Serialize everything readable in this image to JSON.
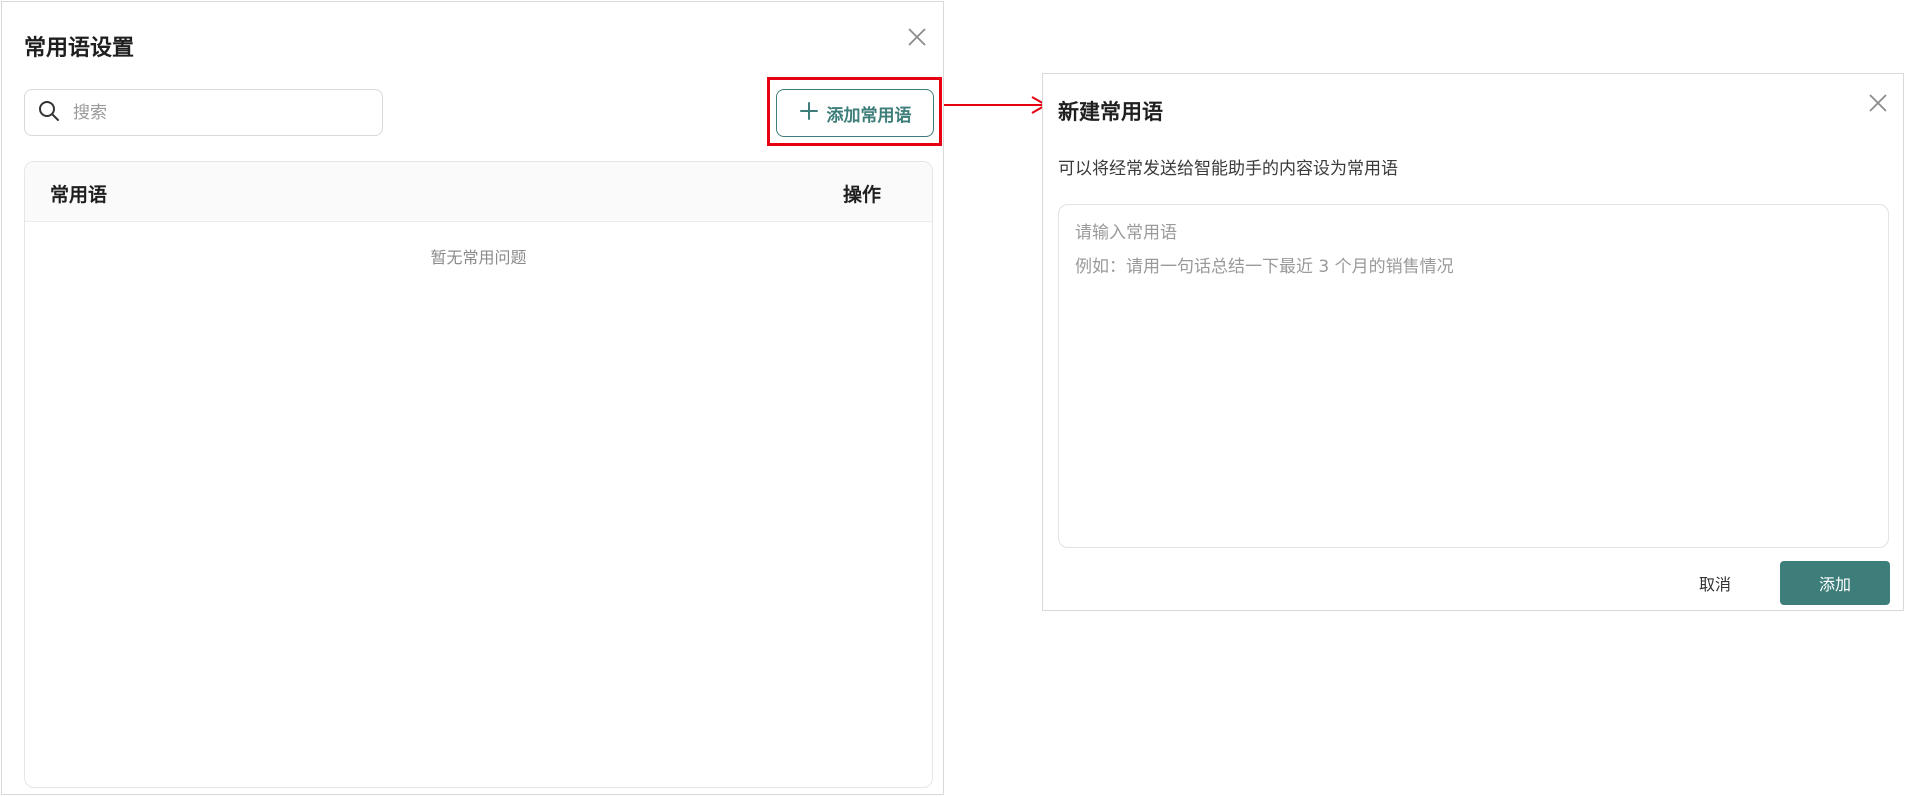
{
  "settings_dialog": {
    "title": "常用语设置",
    "search_placeholder": "搜索",
    "add_button_label": "添加常用语",
    "table": {
      "columns": [
        "常用语",
        "操作"
      ],
      "rows": [],
      "empty_text": "暂无常用问题"
    },
    "icons": {
      "close": "close-icon",
      "search": "search-icon",
      "add": "plus-icon"
    }
  },
  "new_phrase_dialog": {
    "title": "新建常用语",
    "description": "可以将经常发送给智能助手的内容设为常用语",
    "textarea_placeholder": "请输入常用语\n例如：请用一句话总结一下最近 3 个月的销售情况",
    "cancel_label": "取消",
    "submit_label": "添加"
  },
  "colors": {
    "accent": "#3d7d7a",
    "highlight": "#e60012",
    "border": "#d9d9d9"
  }
}
